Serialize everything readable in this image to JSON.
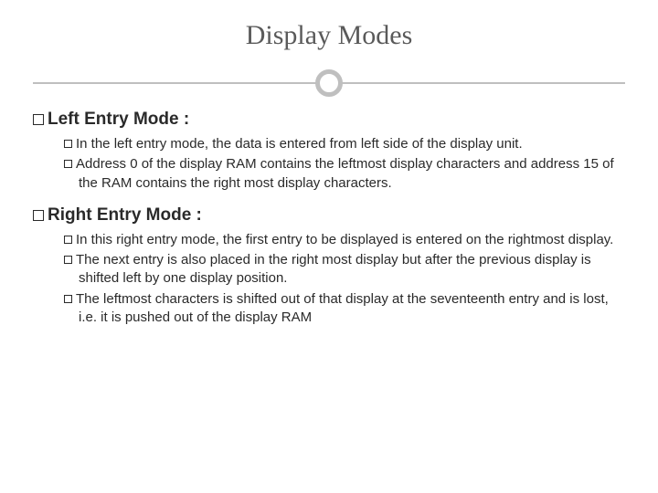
{
  "title": "Display Modes",
  "sections": [
    {
      "heading": "Left Entry Mode :",
      "items": [
        "In the left entry mode, the data is entered from left side of the display unit.",
        "Address 0 of the display RAM contains the leftmost display characters and address 15 of the RAM contains the right most display characters."
      ]
    },
    {
      "heading": "Right Entry Mode :",
      "items": [
        "In this right entry mode, the first entry to be displayed is entered on the rightmost display.",
        "The next entry is also placed in the right most display but after the previous display is shifted left by one display position.",
        "The leftmost characters is shifted out of that display at the seventeenth entry and is lost, i.e. it is pushed out of the display RAM"
      ]
    }
  ]
}
